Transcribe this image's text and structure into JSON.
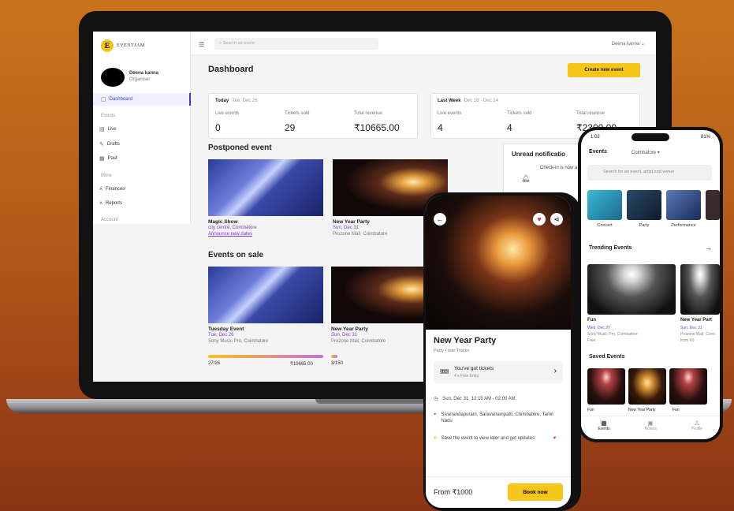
{
  "laptop": {
    "logo": {
      "mark": "E",
      "text": "EVENTJAM"
    },
    "user": {
      "name": "Deena kanna",
      "role": "Organiser"
    },
    "sidebar": {
      "dashboard": "Dashboard",
      "events_section": "Events",
      "live": "Live",
      "drafts": "Drafts",
      "past": "Past",
      "more_section": "More",
      "finances": "Finances",
      "reports": "Reports",
      "account_section": "Account"
    },
    "topbar": {
      "search_placeholder": "Search an event",
      "user": "Deena kanna"
    },
    "title": "Dashboard",
    "create_button": "Create new event",
    "today": {
      "label": "Today",
      "date": "Tue, Dec 26",
      "live_label": "Live events",
      "live_value": "0",
      "tickets_label": "Tickets sold",
      "tickets_value": "29",
      "revenue_label": "Total revenue",
      "revenue_value": "₹10665.00"
    },
    "last_week": {
      "label": "Last Week",
      "date": "Dec 18 - Dec 24",
      "live_label": "Live events",
      "live_value": "4",
      "tickets_label": "Tickets sold",
      "tickets_value": "4",
      "revenue_label": "Total revenue",
      "revenue_value": "₹2300.00"
    },
    "postponed": {
      "title": "Postponed event",
      "cards": [
        {
          "name": "Magic Show",
          "place": "city centre, Coimbatore",
          "action": "Announce new dates"
        },
        {
          "name": "New Year Party",
          "date": "Sun, Dec 31",
          "place": "Prozone Mall, Coimbatore"
        }
      ]
    },
    "on_sale": {
      "title": "Events on sale",
      "cards": [
        {
          "name": "Tuesday Event",
          "date": "Tue, Dec 26",
          "place": "Sony Music Pro, Coimbatore",
          "sold": "27/26",
          "revenue": "₹10665.00",
          "progress": 1.0
        },
        {
          "name": "New Year Party",
          "date": "Sun, Dec 31",
          "place": "Prozone Mall, Coimbatore",
          "sold": "3/150",
          "progress": 0.02
        }
      ]
    },
    "notifications": {
      "title": "Unread notificatio",
      "text": "Check-in is now a for Nucleya's Bangalo Music"
    }
  },
  "phone_detail": {
    "title": "New Year Party",
    "subtitle": "Party • rate Tracks",
    "ticket_title": "You've got tickets",
    "ticket_sub": "4 x Free Entry",
    "datetime": "Sun, Dec 31, 12:15 AM - 02:00 AM",
    "address": "Sivanandapuram, Saravanampatti, Coimbatore, Tamil Nadu",
    "save_text": "Save the event to view later and get updates",
    "price": "From ₹1000",
    "book_button": "Book now"
  },
  "phone_browse": {
    "time": "1:02",
    "battery": "81%",
    "header": "Events",
    "location": "Coimbatore",
    "search_placeholder": "Search for an event, artist and venue",
    "categories": [
      "Concert",
      "Party",
      "Performance"
    ],
    "trending_title": "Trending Events",
    "trending": [
      {
        "name": "Fun",
        "date": "Wed, Dec 27",
        "place": "Sony Music Pro, Coimbatore",
        "price": "Free"
      },
      {
        "name": "New Year Part",
        "date": "Sun, Dec 31",
        "place": "Prozone Mall, Coim",
        "price": "from ₹0"
      }
    ],
    "saved_title": "Saved Events",
    "saved": [
      "Fun",
      "New Year Party",
      "Fun"
    ],
    "tabs": [
      "Events",
      "Tickets",
      "Profile"
    ]
  }
}
